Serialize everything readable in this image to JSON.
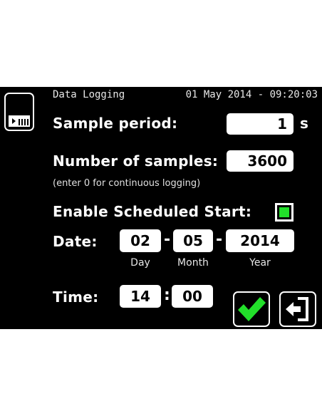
{
  "header": {
    "title": "Data Logging",
    "datetime": "01 May 2014 - 09:20:03"
  },
  "sample_period": {
    "label": "Sample period:",
    "value": "1",
    "unit": "s"
  },
  "num_samples": {
    "label": "Number of samples:",
    "value": "3600",
    "hint": "(enter 0 for continuous logging)"
  },
  "scheduled_start": {
    "label": "Enable Scheduled Start:",
    "checked": true,
    "check_color": "#22e02a"
  },
  "date": {
    "label": "Date:",
    "day": "02",
    "month": "05",
    "year": "2014",
    "separator": "-",
    "day_caption": "Day",
    "month_caption": "Month",
    "year_caption": "Year"
  },
  "time": {
    "label": "Time:",
    "hour": "14",
    "minute": "00",
    "separator": ":"
  },
  "icons": {
    "storage": "sd-card-icon",
    "confirm": "checkmark-icon",
    "exit": "exit-icon"
  },
  "colors": {
    "background": "#000000",
    "field": "#ffffff",
    "accent_green": "#22e02a"
  }
}
